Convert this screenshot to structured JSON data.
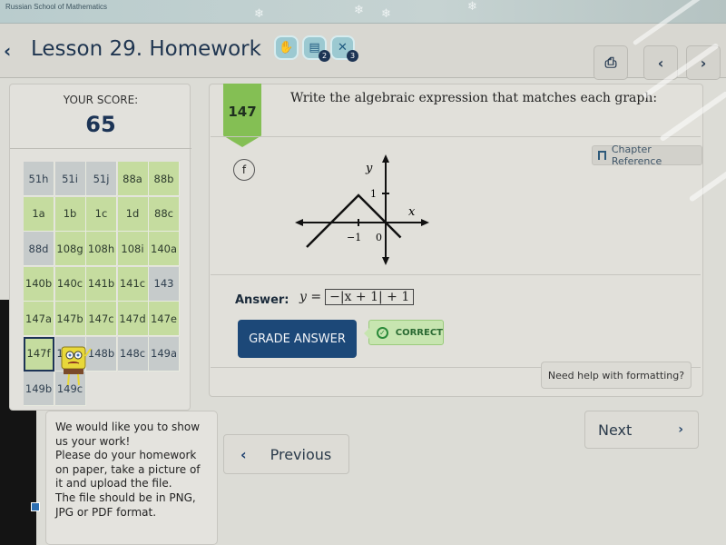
{
  "banner": {
    "school_name": "Russian School of Mathematics"
  },
  "header": {
    "back_icon": "chevron-left-icon",
    "title": "Lesson 29. Homework",
    "badges": [
      {
        "icon": "hand-icon",
        "count": ""
      },
      {
        "icon": "books-icon",
        "count": "2"
      },
      {
        "icon": "tools-icon",
        "count": "3"
      }
    ],
    "print_icon": "printer-icon",
    "prev_icon": "chevron-left-icon",
    "next_icon": "chevron-right-icon"
  },
  "score": {
    "label": "YOUR SCORE:",
    "value": "65"
  },
  "problems": [
    {
      "id": "51h",
      "status": "gray"
    },
    {
      "id": "51i",
      "status": "gray"
    },
    {
      "id": "51j",
      "status": "gray"
    },
    {
      "id": "88a",
      "status": "green"
    },
    {
      "id": "88b",
      "status": "green"
    },
    {
      "id": "1a",
      "status": "green"
    },
    {
      "id": "1b",
      "status": "green"
    },
    {
      "id": "1c",
      "status": "green"
    },
    {
      "id": "1d",
      "status": "green"
    },
    {
      "id": "88c",
      "status": "green"
    },
    {
      "id": "88d",
      "status": "gray"
    },
    {
      "id": "108g",
      "status": "green"
    },
    {
      "id": "108h",
      "status": "green"
    },
    {
      "id": "108i",
      "status": "green"
    },
    {
      "id": "140a",
      "status": "green"
    },
    {
      "id": "140b",
      "status": "green"
    },
    {
      "id": "140c",
      "status": "green"
    },
    {
      "id": "141b",
      "status": "green"
    },
    {
      "id": "141c",
      "status": "green"
    },
    {
      "id": "143",
      "status": "gray"
    },
    {
      "id": "147a",
      "status": "green"
    },
    {
      "id": "147b",
      "status": "green"
    },
    {
      "id": "147c",
      "status": "green"
    },
    {
      "id": "147d",
      "status": "green"
    },
    {
      "id": "147e",
      "status": "green"
    },
    {
      "id": "147f",
      "status": "current"
    },
    {
      "id": "148a",
      "status": "gray"
    },
    {
      "id": "148b",
      "status": "gray"
    },
    {
      "id": "148c",
      "status": "gray"
    },
    {
      "id": "149a",
      "status": "gray"
    },
    {
      "id": "149b",
      "status": "gray"
    },
    {
      "id": "149c",
      "status": "gray"
    }
  ],
  "upload_info": {
    "lines": [
      "We would like you to show us your work!",
      "Please do your homework on paper, take a picture of it and upload the file.",
      "The file should be in PNG, JPG or PDF format."
    ]
  },
  "question": {
    "number": "147",
    "prompt": "Write the algebraic expression that matches each graph:",
    "chapter_reference": "Chapter Reference",
    "part": "f",
    "graph": {
      "x_label": "x",
      "y_label": "y",
      "x_tick_neg1": "−1",
      "origin_label": "0",
      "y_tick_1": "1",
      "vertex": [
        -1,
        1
      ]
    },
    "answer_label": "Answer:",
    "answer_prefix": "y =",
    "answer_value": "−|x + 1| + 1",
    "grade_button": "GRADE ANSWER",
    "status": "CORRECT",
    "help_button": "Need help with formatting?"
  },
  "nav": {
    "previous": "Previous",
    "next": "Next"
  }
}
